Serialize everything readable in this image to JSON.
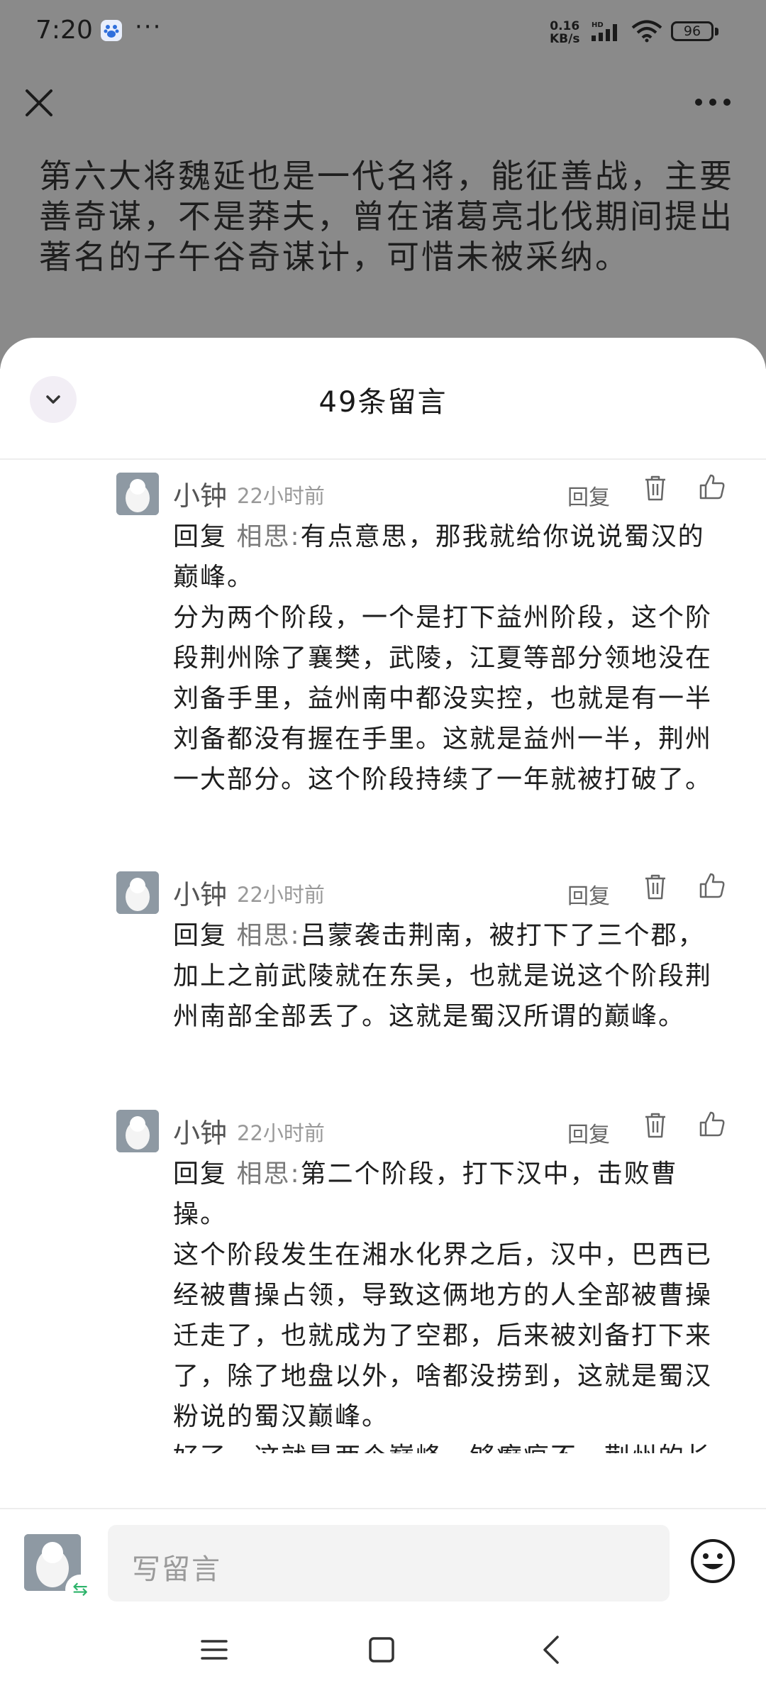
{
  "status_bar": {
    "time": "7:20",
    "dots": "···",
    "net_speed_value": "0.16",
    "net_speed_unit": "KB/s",
    "network_badge": "HD",
    "battery": "96"
  },
  "article": {
    "text": "第六大将魏延也是一代名将，能征善战，主要善奇谋，不是莽夫，曾在诸葛亮北伐期间提出著名的子午谷奇谋计，可惜未被采纳。"
  },
  "sheet": {
    "title": "49条留言"
  },
  "comments": [
    {
      "name": "小钟",
      "time": "22小时前",
      "reply_label": "回复",
      "reply_prefix": "回复",
      "mention": "相思:",
      "lines": [
        "有点意思，那我就给你说说蜀汉的巅峰。",
        "分为两个阶段，一个是打下益州阶段，这个阶段荆州除了襄樊，武陵，江夏等部分领地没在刘备手里，益州南中都没实控，也就是有一半刘备都没有握在手里。这就是益州一半，荆州一大部分。这个阶段持续了一年就被打破了。"
      ]
    },
    {
      "name": "小钟",
      "time": "22小时前",
      "reply_label": "回复",
      "reply_prefix": "回复",
      "mention": "相思:",
      "lines": [
        "吕蒙袭击荆南，被打下了三个郡，加上之前武陵就在东吴，也就是说这个阶段荆州南部全部丢了。这就是蜀汉所谓的巅峰。"
      ]
    },
    {
      "name": "小钟",
      "time": "22小时前",
      "reply_label": "回复",
      "reply_prefix": "回复",
      "mention": "相思:",
      "lines": [
        "第二个阶段，打下汉中，击败曹操。",
        "这个阶段发生在湘水化界之后，汉中，巴西已经被曹操占领，导致这俩地方的人全部被曹操迁走了，也就成为了空郡，后来被刘备打下来了，除了地盘以外，啥都没捞到，这就是蜀汉粉说的蜀汉巅峰。",
        "好了，这就是两个巅峰，够癫疯不。荆州的长沙，桂阳，江夏全归了东吴。"
      ]
    }
  ],
  "input": {
    "placeholder": "写留言",
    "switch_symbol": "⇆"
  },
  "icons": {
    "close": "close-icon",
    "more": "more-icon",
    "collapse": "chevron-down-icon",
    "delete": "trash-icon",
    "like": "thumbs-up-icon",
    "emoji": "emoji-icon",
    "nav": [
      "menu-icon",
      "home-icon",
      "back-icon"
    ]
  },
  "colors": {
    "dim_overlay": "#8a8a8a",
    "sheet_background": "#ffffff",
    "input_background": "#f3f3f3",
    "switch_badge": "#2cb36a"
  }
}
